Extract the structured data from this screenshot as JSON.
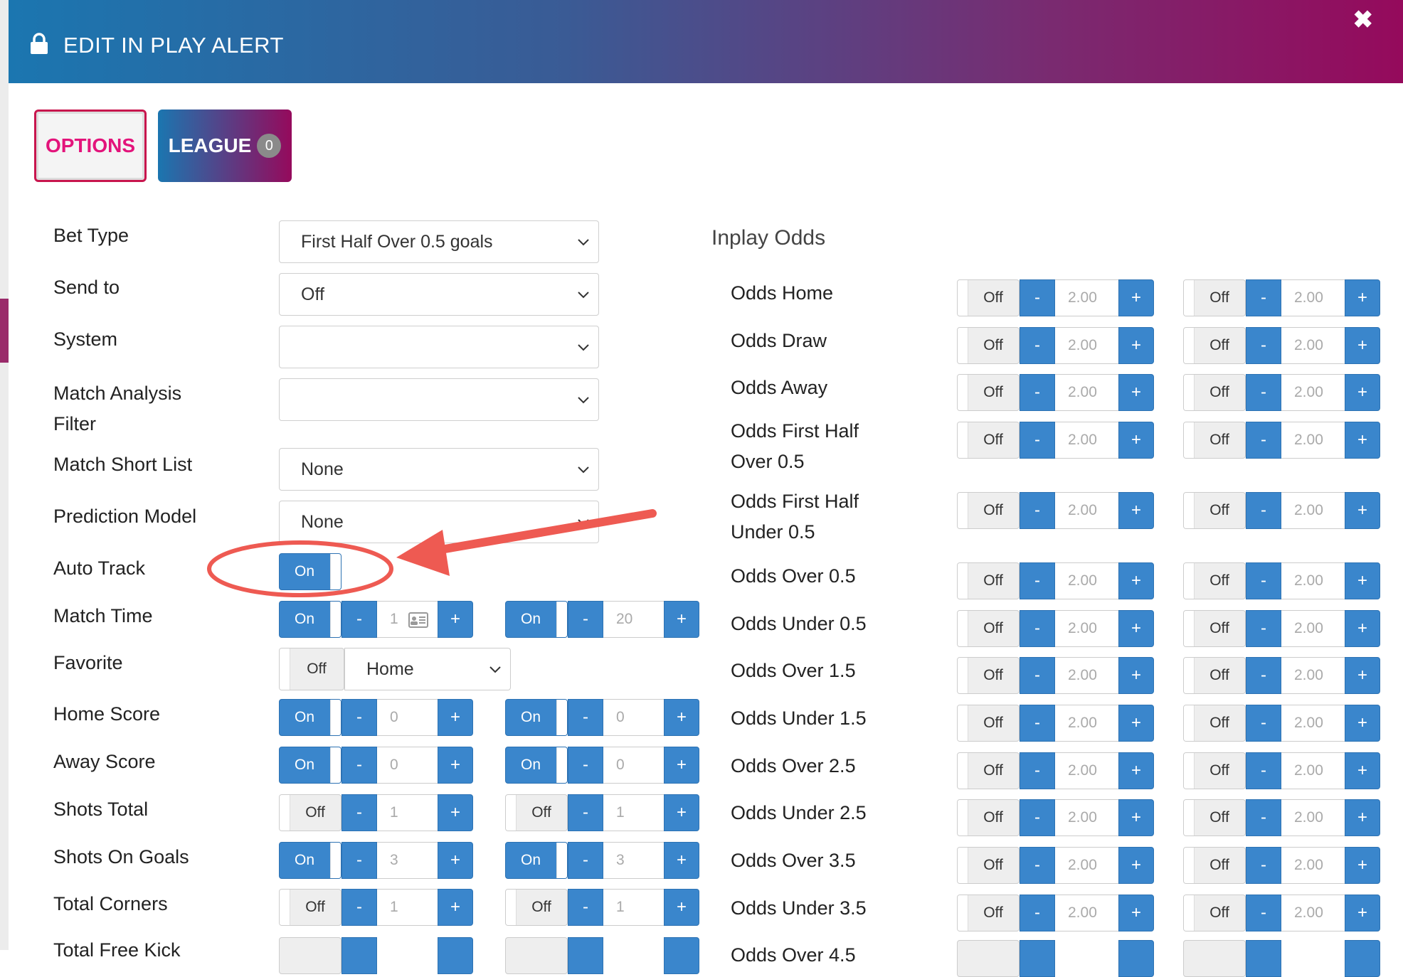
{
  "modal": {
    "title": "EDIT IN PLAY ALERT",
    "close": "✖"
  },
  "tabs": {
    "options": "OPTIONS",
    "league": "LEAGUE",
    "league_count": "0"
  },
  "form": {
    "bet_type": {
      "label": "Bet Type",
      "value": "First Half Over 0.5 goals"
    },
    "send_to": {
      "label": "Send to",
      "value": "Off"
    },
    "system": {
      "label": "System",
      "value": ""
    },
    "match_analysis": {
      "label_1": "Match Analysis",
      "label_2": "Filter",
      "value": ""
    },
    "match_short_list": {
      "label": "Match Short List",
      "value": "None"
    },
    "prediction_model": {
      "label": "Prediction Model",
      "value": "None"
    },
    "auto_track": {
      "label": "Auto Track",
      "state": "On"
    },
    "match_time": {
      "label": "Match Time",
      "a": {
        "state": "On",
        "value": "1"
      },
      "b": {
        "state": "On",
        "value": "20"
      }
    },
    "favorite": {
      "label": "Favorite",
      "state": "Off",
      "value": "Home"
    },
    "home_score": {
      "label": "Home Score",
      "a": {
        "state": "On",
        "value": "0"
      },
      "b": {
        "state": "On",
        "value": "0"
      }
    },
    "away_score": {
      "label": "Away Score",
      "a": {
        "state": "On",
        "value": "0"
      },
      "b": {
        "state": "On",
        "value": "0"
      }
    },
    "shots_total": {
      "label": "Shots Total",
      "a": {
        "state": "Off",
        "value": "1"
      },
      "b": {
        "state": "Off",
        "value": "1"
      }
    },
    "shots_on_goals": {
      "label": "Shots On Goals",
      "a": {
        "state": "On",
        "value": "3"
      },
      "b": {
        "state": "On",
        "value": "3"
      }
    },
    "total_corners": {
      "label": "Total Corners",
      "a": {
        "state": "Off",
        "value": "1"
      },
      "b": {
        "state": "Off",
        "value": "1"
      }
    },
    "total_free_kick": {
      "label": "Total Free Kick"
    }
  },
  "inplay_odds": {
    "title": "Inplay Odds",
    "rows": [
      {
        "label": "Odds Home",
        "a": {
          "state": "Off",
          "value": "2.00"
        },
        "b": {
          "state": "Off",
          "value": "2.00"
        }
      },
      {
        "label": "Odds Draw",
        "a": {
          "state": "Off",
          "value": "2.00"
        },
        "b": {
          "state": "Off",
          "value": "2.00"
        }
      },
      {
        "label": "Odds Away",
        "a": {
          "state": "Off",
          "value": "2.00"
        },
        "b": {
          "state": "Off",
          "value": "2.00"
        }
      },
      {
        "label_1": "Odds First Half",
        "label_2": "Over 0.5",
        "a": {
          "state": "Off",
          "value": "2.00"
        },
        "b": {
          "state": "Off",
          "value": "2.00"
        }
      },
      {
        "label_1": "Odds First Half",
        "label_2": "Under 0.5",
        "a": {
          "state": "Off",
          "value": "2.00"
        },
        "b": {
          "state": "Off",
          "value": "2.00"
        }
      },
      {
        "label": "Odds Over 0.5",
        "a": {
          "state": "Off",
          "value": "2.00"
        },
        "b": {
          "state": "Off",
          "value": "2.00"
        }
      },
      {
        "label": "Odds Under 0.5",
        "a": {
          "state": "Off",
          "value": "2.00"
        },
        "b": {
          "state": "Off",
          "value": "2.00"
        }
      },
      {
        "label": "Odds Over 1.5",
        "a": {
          "state": "Off",
          "value": "2.00"
        },
        "b": {
          "state": "Off",
          "value": "2.00"
        }
      },
      {
        "label": "Odds Under 1.5",
        "a": {
          "state": "Off",
          "value": "2.00"
        },
        "b": {
          "state": "Off",
          "value": "2.00"
        }
      },
      {
        "label": "Odds Over 2.5",
        "a": {
          "state": "Off",
          "value": "2.00"
        },
        "b": {
          "state": "Off",
          "value": "2.00"
        }
      },
      {
        "label": "Odds Under 2.5",
        "a": {
          "state": "Off",
          "value": "2.00"
        },
        "b": {
          "state": "Off",
          "value": "2.00"
        }
      },
      {
        "label": "Odds Over 3.5",
        "a": {
          "state": "Off",
          "value": "2.00"
        },
        "b": {
          "state": "Off",
          "value": "2.00"
        }
      },
      {
        "label": "Odds Under 3.5",
        "a": {
          "state": "Off",
          "value": "2.00"
        },
        "b": {
          "state": "Off",
          "value": "2.00"
        }
      },
      {
        "label": "Odds Over 4.5"
      }
    ]
  },
  "stepper": {
    "minus": "-",
    "plus": "+"
  },
  "colors": {
    "accent": "#3a86cc",
    "brand_pink": "#e3147b",
    "annotation": "#ee5a52"
  },
  "icons": {
    "lock": "lock-icon",
    "close": "close-icon",
    "chevron": "chevron-down-icon",
    "contact_card": "contact-card-icon"
  }
}
